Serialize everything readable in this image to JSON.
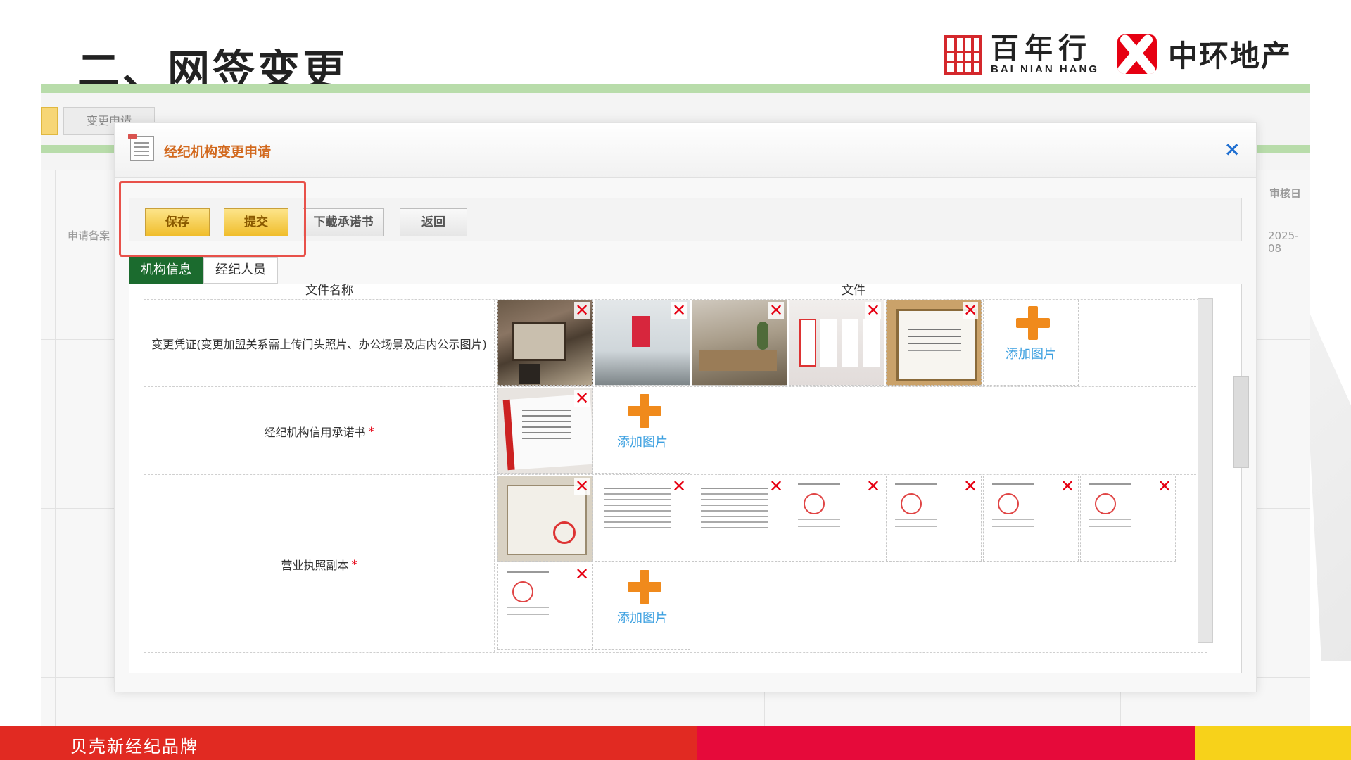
{
  "slide": {
    "title": "二、网签变更",
    "footer": "贝壳新经纪品牌"
  },
  "logos": {
    "bnh_cn": "百年行",
    "bnh_en": "BAI NIAN HANG",
    "zh": "中环地产"
  },
  "background": {
    "tab_label": "变更申请",
    "row_text": "申请备案",
    "col_header": "审核日",
    "col_date": "2025-08"
  },
  "dialog": {
    "title": "经纪机构变更申请",
    "close_icon": "×",
    "buttons": {
      "save": "保存",
      "submit": "提交",
      "download": "下载承诺书",
      "back": "返回"
    },
    "tabs": [
      {
        "label": "机构信息"
      },
      {
        "label": "经纪人员"
      }
    ],
    "table": {
      "headers": [
        "文件名称",
        "文件"
      ],
      "rows": [
        {
          "label": "变更凭证(变更加盟关系需上传门头照片、办公场景及店内公示图片)",
          "required": ""
        },
        {
          "label": "经纪机构信用承诺书",
          "required": "*"
        },
        {
          "label": "营业执照副本",
          "required": "*"
        }
      ],
      "add_label": "添加图片",
      "remove_icon": "✕"
    }
  },
  "colors": {
    "highlight": "#e8514a",
    "active_tab": "#1b6b2e",
    "add_plus": "#f08a1c",
    "add_text": "#3ca0e0"
  }
}
